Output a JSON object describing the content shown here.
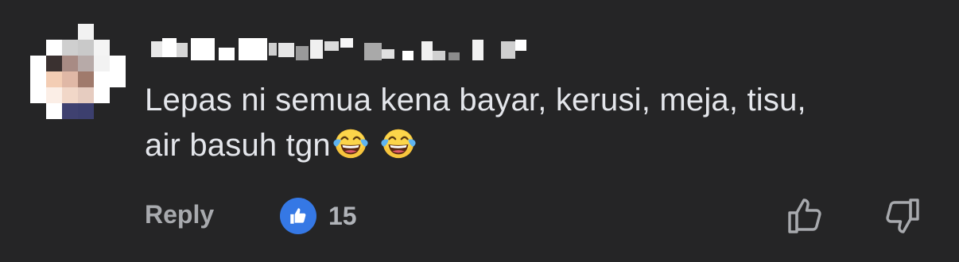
{
  "comment": {
    "author_name": "",
    "text_line1": "Lepas ni semua kena bayar, kerusi, meja, tisu,",
    "text_line2": "air basuh tgn",
    "emojis": [
      "face-with-tears-of-joy-icon",
      "face-with-tears-of-joy-icon"
    ],
    "reply_label": "Reply",
    "like_count": "15",
    "reaction_icon": "like-thumbs-up-icon",
    "colors": {
      "background": "#252526",
      "text": "#e4e6eb",
      "secondary_text": "#a8aaae",
      "like_badge": "#3578e5"
    }
  }
}
